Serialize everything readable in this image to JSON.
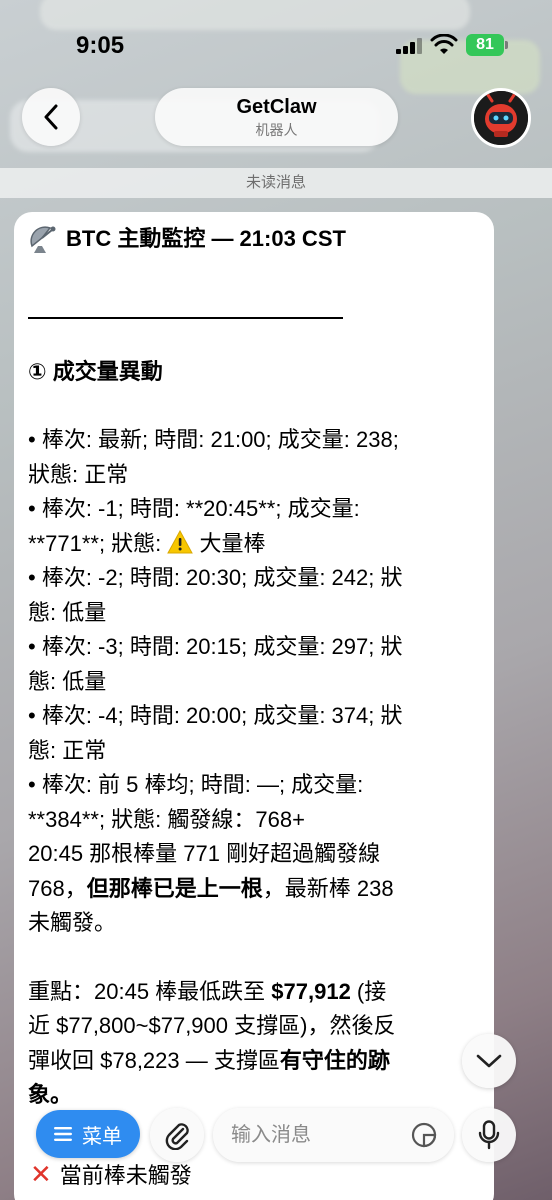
{
  "status_bar": {
    "time": "9:05",
    "battery": "81"
  },
  "header": {
    "title": "GetClaw",
    "subtitle": "机器人"
  },
  "unread_banner": "未读消息",
  "message": {
    "title": "BTC 主動監控 — 21:03 CST",
    "section_heading": "① 成交量異動",
    "lines": [
      "• 棒次: 最新; 時間: 21:00; 成交量: 238;",
      "狀態: 正常",
      "• 棒次: -1; 時間: **20:45**; 成交量:",
      "**771**; 狀態: ",
      " 大量棒",
      "• 棒次: -2; 時間: 20:30; 成交量: 242; 狀",
      "態: 低量",
      "• 棒次: -3; 時間: 20:15; 成交量: 297; 狀",
      "態: 低量",
      "• 棒次: -4; 時間: 20:00; 成交量: 374; 狀",
      "態: 正常",
      "• 棒次: 前 5 棒均; 時間: —; 成交量:",
      "**384**; 狀態: 觸發線：768+",
      "20:45 那根棒量 771 剛好超過觸發線",
      "768，",
      "但那棒已是上一根",
      "，最新棒 238",
      "未觸發。"
    ],
    "focus": {
      "prefix": "重點：20:45 棒最低跌至 ",
      "price_low": "$77,912",
      "suffix1": " (接",
      "line2": "近 $77,800~$77,900 支撐區)，然後反",
      "line3_a": "彈收回 $78,223 — 支撐區",
      "line3_b": "有守住的跡",
      "line4": "象。"
    }
  },
  "footer_text": "當前棒未觸發",
  "input_bar": {
    "menu_label": "菜单",
    "input_placeholder": "输入消息"
  },
  "colors": {
    "menu_blue": "#2f8cf0",
    "battery_green": "#34c759",
    "warning_yellow": "#f7c600",
    "error_red": "#e0342b"
  },
  "icons": [
    "back-chevron-icon",
    "bot-avatar-icon",
    "satellite-antenna-icon",
    "warning-icon",
    "chevron-down-icon",
    "menu-lines-icon",
    "paperclip-icon",
    "sticker-icon",
    "microphone-icon",
    "cross-mark-icon",
    "signal-icon",
    "wifi-icon",
    "battery-icon"
  ]
}
